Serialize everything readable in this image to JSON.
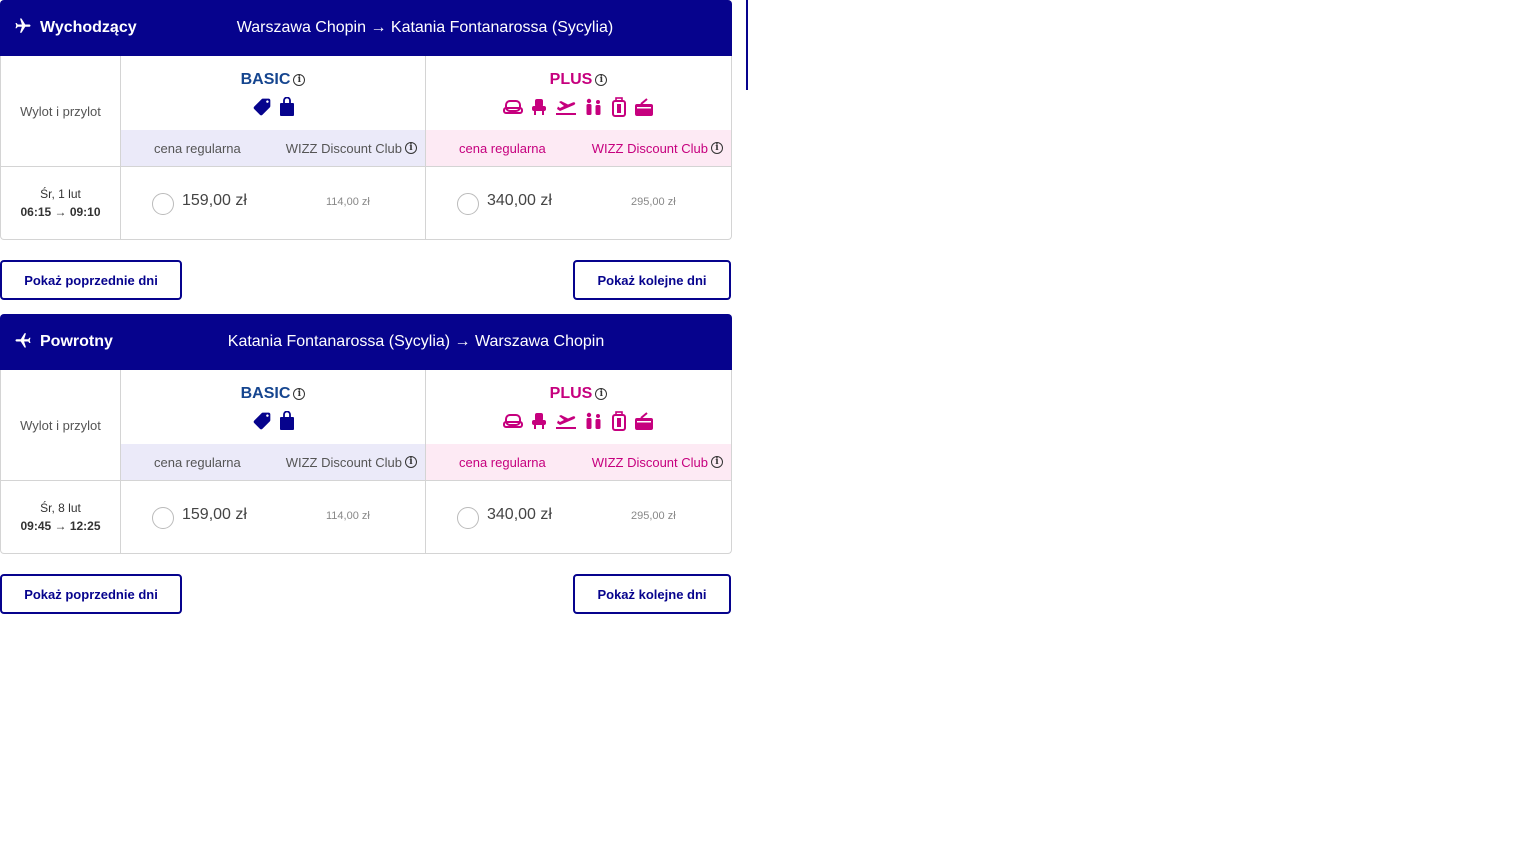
{
  "flights": {
    "outbound": {
      "direction_label": "Wychodzący",
      "route": "Warszawa Chopin → Katania Fontanarossa (Sycylia)",
      "row_label": "Wylot i przylot",
      "basic": {
        "name": "BASIC",
        "regular_label": "cena regularna",
        "club_label": "WIZZ Discount Club",
        "icons": [
          "tag-icon",
          "bag-icon"
        ]
      },
      "plus": {
        "name": "PLUS",
        "regular_label": "cena regularna",
        "club_label": "WIZZ Discount Club",
        "icons": [
          "seat-icon",
          "armchair-icon",
          "takeoff-icon",
          "family-icon",
          "trolley-bag-icon",
          "checked-bag-icon"
        ]
      },
      "date": "Śr, 1 lut",
      "times": "06:15 → 09:10",
      "basic_price": "159,00 zł",
      "basic_club_price": "114,00 zł",
      "plus_price": "340,00 zł",
      "plus_club_price": "295,00 zł",
      "prev_button": "Pokaż poprzednie dni",
      "next_button": "Pokaż kolejne dni"
    },
    "return": {
      "direction_label": "Powrotny",
      "route": "Katania Fontanarossa (Sycylia) → Warszawa Chopin",
      "row_label": "Wylot i przylot",
      "basic": {
        "name": "BASIC",
        "regular_label": "cena regularna",
        "club_label": "WIZZ Discount Club",
        "icons": [
          "tag-icon",
          "bag-icon"
        ]
      },
      "plus": {
        "name": "PLUS",
        "regular_label": "cena regularna",
        "club_label": "WIZZ Discount Club",
        "icons": [
          "seat-icon",
          "armchair-icon",
          "takeoff-icon",
          "family-icon",
          "trolley-bag-icon",
          "checked-bag-icon"
        ]
      },
      "date": "Śr, 8 lut",
      "times": "09:45 → 12:25",
      "basic_price": "159,00 zł",
      "basic_club_price": "114,00 zł",
      "plus_price": "340,00 zł",
      "plus_club_price": "295,00 zł",
      "prev_button": "Pokaż poprzednie dni",
      "next_button": "Pokaż kolejne dni"
    }
  },
  "colors": {
    "brand_navy": "#06038d",
    "basic_blue": "#15458f",
    "plus_pink": "#c6007e",
    "basic_bg": "#ebeaf9",
    "plus_bg": "#fdeaf4"
  }
}
